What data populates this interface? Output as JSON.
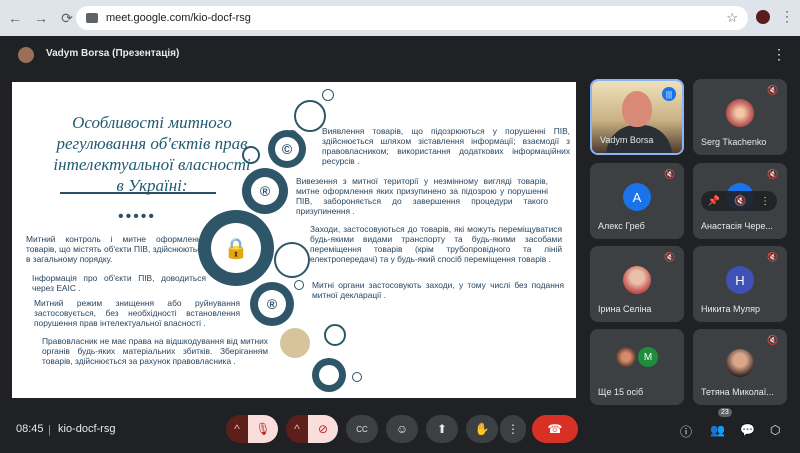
{
  "browser": {
    "url": "meet.google.com/kio-docf-rsg",
    "back_icon": "←",
    "forward_icon": "→",
    "reload_icon": "⟳",
    "star_icon": "☆",
    "more_icon": "⋮"
  },
  "presentation": {
    "title": "Vadym Borsa (Презентація)",
    "more_icon": "⋮"
  },
  "slide": {
    "heading": "Особливості митного регулювання об'єктів прав інтелектуальної власності в Україні:",
    "dots": "•••••",
    "left_paragraphs": [
      "Митний контроль і митне оформлення товарів, що містять об'єкти ПІВ, здійснюються в загальному порядку.",
      "Інформація про об'єкти ПІВ, доводиться через ЕАІС .",
      "Митний режим знищення або руйнування застосовується, без необхідності встановлення порушення прав інтелектуальної власності .",
      "Правовласник не має права на відшкодування від митних органів будь-яких матеріальних збитків. Зберіганням товарів, здійснюється за рахунок правовласника ."
    ],
    "right_paragraphs": [
      "Виявлення товарів, що підозрюються у порушенні ПІВ, здійснюється шляхом зіставлення інформації; взаємодії з правовласником; використання додаткових інформаційних ресурсів .",
      "Вивезення з митної території у незмінному вигляді товарів, митне оформлення яких призупинено за підозрою у порушенні ПІВ, забороняється до завершення процедури такого призупинення .",
      "Заходи, застосовуються до товарів, які можуть переміщуватися будь-якими видами транспорту та будь-якими засобами переміщення товарів (крім трубопровідного та ліній електропередачі) та у будь-який спосіб переміщення товарів .",
      "Митні органи застосовують заходи, у тому числі без подання митної декларації ."
    ],
    "icon_symbols": [
      "©",
      "®",
      "®",
      "🔒"
    ]
  },
  "participants": [
    {
      "name": "Vadym Borsa",
      "type": "video",
      "speaking": true
    },
    {
      "name": "Serg Tkachenko",
      "type": "pattern",
      "muted": true
    },
    {
      "name": "Алекс Греб",
      "initial": "A",
      "color": "#1a73e8",
      "muted": true
    },
    {
      "name": "Анастасія Чере...",
      "initial": "A",
      "color": "#1a73e8",
      "muted": true
    },
    {
      "name": "Ірина Селіна",
      "type": "photo",
      "muted": true
    },
    {
      "name": "Никита Муляр",
      "initial": "Н",
      "color": "#3f51b5",
      "muted": true
    },
    {
      "name": "Ще 15 осіб",
      "initial": "M",
      "color": "#1e8e3e"
    },
    {
      "name": "Тетяна Миколаї...",
      "type": "photo",
      "muted": true
    }
  ],
  "tile_hover": {
    "pin_icon": "📌",
    "mute_icon": "🔇",
    "more_icon": "⋮"
  },
  "bottom": {
    "time": "08:45",
    "separator": "|",
    "meeting_code": "kio-docf-rsg",
    "participant_count": "23",
    "icons": {
      "chevron": "^",
      "mic_off": "🎙",
      "cam_off": "⊘",
      "captions": "CC",
      "emoji": "☺",
      "present": "⬆",
      "raise_hand": "✋",
      "more": "⋮",
      "end_call": "☎",
      "info": "ⓘ",
      "people": "👥",
      "chat": "💬",
      "activities": "⬡"
    }
  },
  "colors": {
    "meet_bg": "#202124",
    "tile_bg": "#3c4043",
    "slide_text": "#28455f",
    "slide_accent": "#2f5668",
    "end_call": "#d93025"
  }
}
